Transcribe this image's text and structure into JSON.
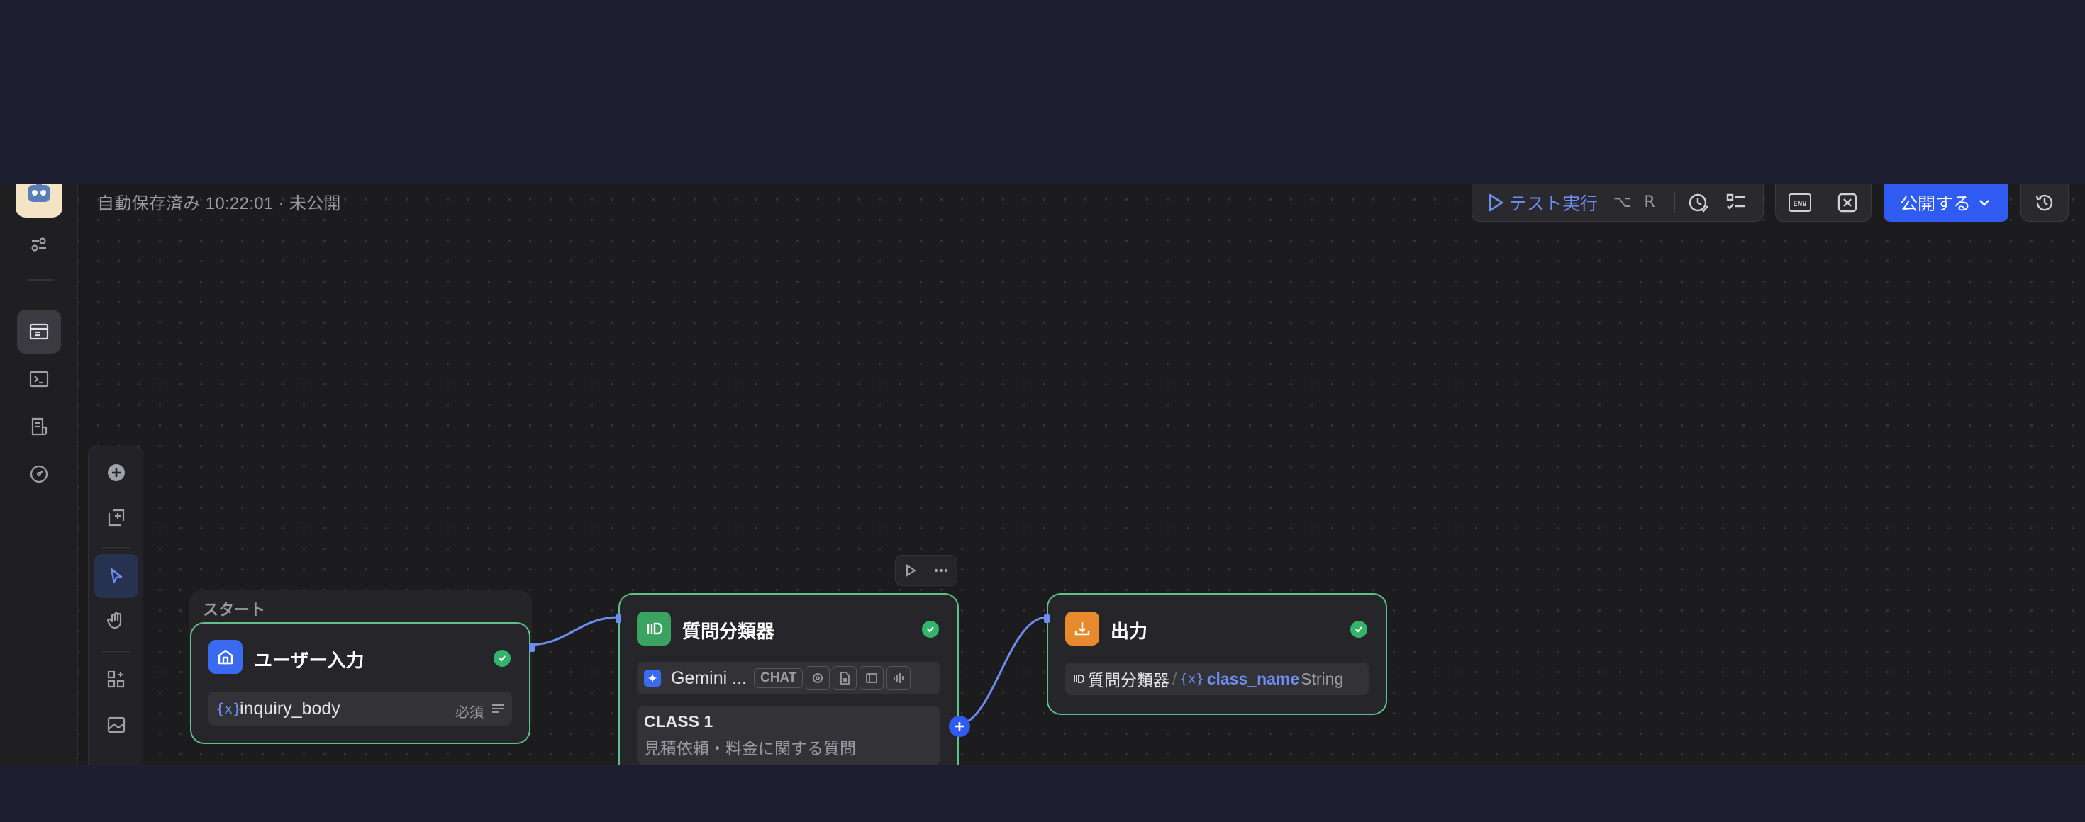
{
  "header": {
    "save_status": "自動保存済み 10:22:01 · 未公開",
    "test_run_label": "テスト実行",
    "shortcut_modifier": "⌥",
    "shortcut_key": "R",
    "publish_label": "公開する"
  },
  "start_group": {
    "label": "スタート"
  },
  "nodes": {
    "user_input": {
      "title": "ユーザー入力",
      "variable": "inquiry_body",
      "required_label": "必須"
    },
    "classifier": {
      "title": "質問分類器",
      "model_name": "Gemini ...",
      "model_mode": "CHAT",
      "class_name": "CLASS 1",
      "class_description": "見積依頼・料金に関する質問"
    },
    "output": {
      "title": "出力",
      "source_node": "質問分類器",
      "separator": "/",
      "variable": "class_name",
      "type": "String"
    }
  },
  "colors": {
    "accent": "#2f5bf0",
    "success": "#34b36b",
    "node_border": "#5fc18a",
    "edge": "#6d8ef0"
  }
}
